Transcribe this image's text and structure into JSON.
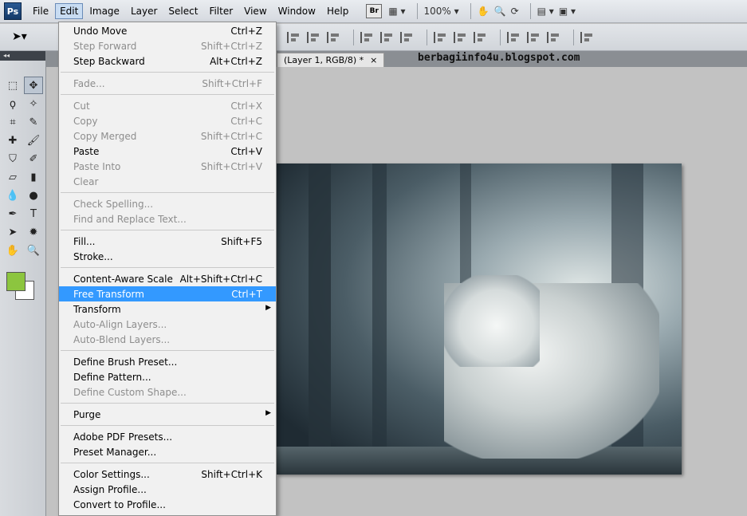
{
  "app": {
    "logo": "Ps"
  },
  "menubar": {
    "items": [
      "File",
      "Edit",
      "Image",
      "Layer",
      "Select",
      "Filter",
      "View",
      "Window",
      "Help"
    ],
    "bridge": "Br",
    "zoom": "100%"
  },
  "document": {
    "tab_title": "(Layer 1, RGB/8) *",
    "close": "×"
  },
  "watermark": "berbagiinfo4u.blogspot.com",
  "colors": {
    "foreground": "#8cc53f",
    "background": "#ffffff",
    "highlight": "#3399ff"
  },
  "edit_menu": {
    "groups": [
      [
        {
          "label": "Undo Move",
          "shortcut": "Ctrl+Z",
          "enabled": true
        },
        {
          "label": "Step Forward",
          "shortcut": "Shift+Ctrl+Z",
          "enabled": false
        },
        {
          "label": "Step Backward",
          "shortcut": "Alt+Ctrl+Z",
          "enabled": true
        }
      ],
      [
        {
          "label": "Fade...",
          "shortcut": "Shift+Ctrl+F",
          "enabled": false
        }
      ],
      [
        {
          "label": "Cut",
          "shortcut": "Ctrl+X",
          "enabled": false
        },
        {
          "label": "Copy",
          "shortcut": "Ctrl+C",
          "enabled": false
        },
        {
          "label": "Copy Merged",
          "shortcut": "Shift+Ctrl+C",
          "enabled": false
        },
        {
          "label": "Paste",
          "shortcut": "Ctrl+V",
          "enabled": true
        },
        {
          "label": "Paste Into",
          "shortcut": "Shift+Ctrl+V",
          "enabled": false
        },
        {
          "label": "Clear",
          "shortcut": "",
          "enabled": false
        }
      ],
      [
        {
          "label": "Check Spelling...",
          "shortcut": "",
          "enabled": false
        },
        {
          "label": "Find and Replace Text...",
          "shortcut": "",
          "enabled": false
        }
      ],
      [
        {
          "label": "Fill...",
          "shortcut": "Shift+F5",
          "enabled": true
        },
        {
          "label": "Stroke...",
          "shortcut": "",
          "enabled": true
        }
      ],
      [
        {
          "label": "Content-Aware Scale",
          "shortcut": "Alt+Shift+Ctrl+C",
          "enabled": true
        },
        {
          "label": "Free Transform",
          "shortcut": "Ctrl+T",
          "enabled": true,
          "highlighted": true
        },
        {
          "label": "Transform",
          "shortcut": "",
          "enabled": true,
          "submenu": true
        },
        {
          "label": "Auto-Align Layers...",
          "shortcut": "",
          "enabled": false
        },
        {
          "label": "Auto-Blend Layers...",
          "shortcut": "",
          "enabled": false
        }
      ],
      [
        {
          "label": "Define Brush Preset...",
          "shortcut": "",
          "enabled": true
        },
        {
          "label": "Define Pattern...",
          "shortcut": "",
          "enabled": true
        },
        {
          "label": "Define Custom Shape...",
          "shortcut": "",
          "enabled": false
        }
      ],
      [
        {
          "label": "Purge",
          "shortcut": "",
          "enabled": true,
          "submenu": true
        }
      ],
      [
        {
          "label": "Adobe PDF Presets...",
          "shortcut": "",
          "enabled": true
        },
        {
          "label": "Preset Manager...",
          "shortcut": "",
          "enabled": true
        }
      ],
      [
        {
          "label": "Color Settings...",
          "shortcut": "Shift+Ctrl+K",
          "enabled": true
        },
        {
          "label": "Assign Profile...",
          "shortcut": "",
          "enabled": true
        },
        {
          "label": "Convert to Profile...",
          "shortcut": "",
          "enabled": true
        }
      ]
    ]
  }
}
